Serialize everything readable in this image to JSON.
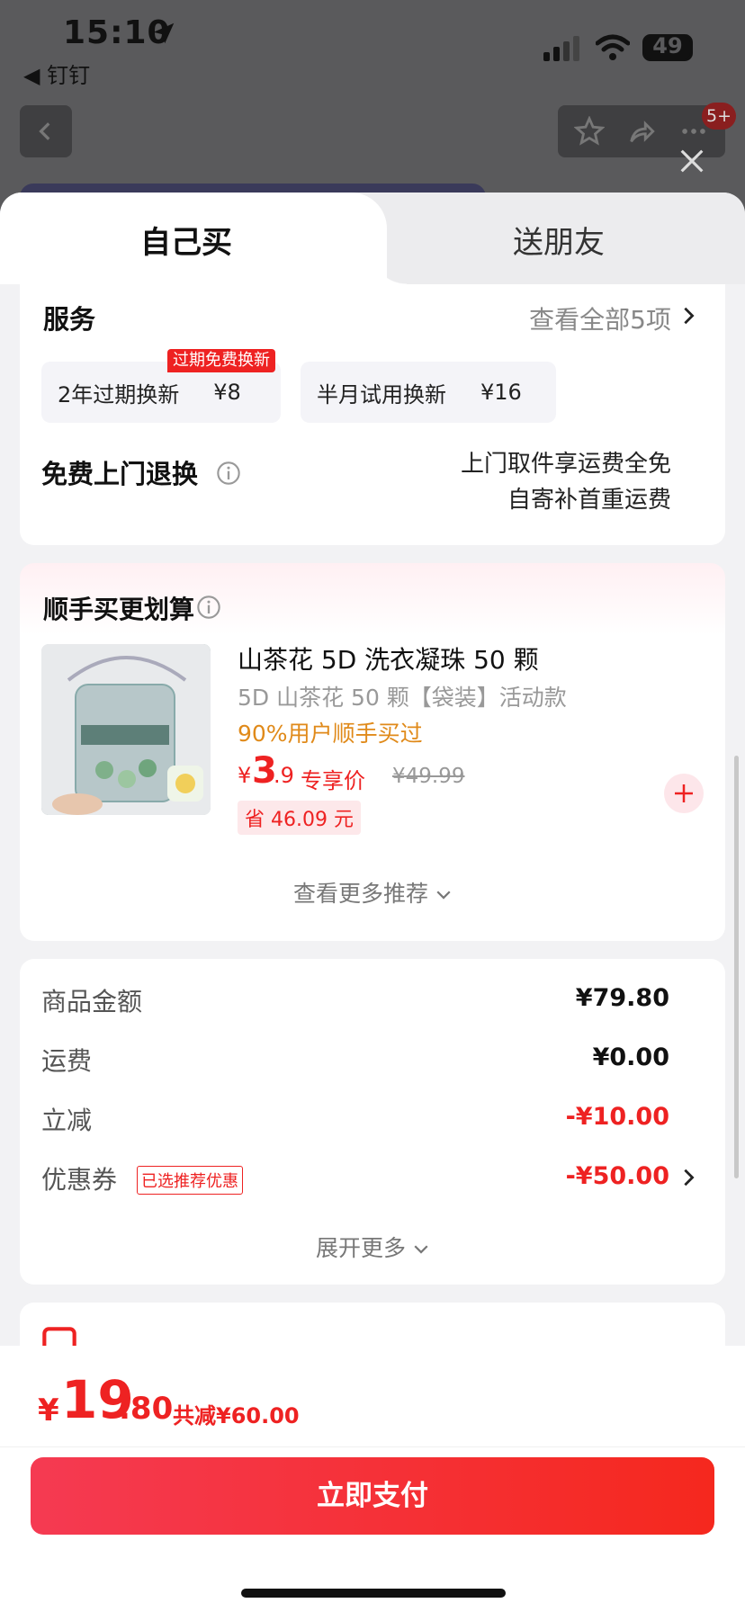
{
  "status": {
    "time": "15:10",
    "back_app": "◀ 钉钉",
    "battery": "49"
  },
  "topbar": {
    "badge": "5+"
  },
  "tabs": [
    {
      "label": "自己买",
      "active": true
    },
    {
      "label": "送朋友",
      "active": false
    }
  ],
  "service": {
    "title": "服务",
    "view_all": "查看全部5项",
    "options": [
      {
        "name": "2年过期换新",
        "price": "¥8",
        "tag": "过期免费换新"
      },
      {
        "name": "半月试用换新",
        "price": "¥16"
      }
    ],
    "return_title": "免费上门退换",
    "return_note_1": "上门取件享运费全免",
    "return_note_2": "自寄补首重运费"
  },
  "recommend": {
    "title": "顺手买更划算",
    "product": {
      "name": "山茶花 5D 洗衣凝珠 50 颗",
      "spec": "5D 山茶花 50 颗【袋装】活动款",
      "buy_rate": "90%用户顺手买过",
      "price_currency": "¥",
      "price_int": "3",
      "price_dec": ".9",
      "price_label": "专享价",
      "original_price": "¥49.99",
      "save": "省 46.09 元"
    },
    "more": "查看更多推荐"
  },
  "summary": {
    "rows": [
      {
        "label": "商品金额",
        "value": "¥79.80"
      },
      {
        "label": "运费",
        "value": "¥0.00"
      },
      {
        "label": "立减",
        "value": "-¥10.00"
      },
      {
        "label": "优惠券",
        "value": "-¥50.00"
      }
    ],
    "coupon_tag": "已选推荐优惠",
    "expand": "展开更多"
  },
  "footer": {
    "currency": "¥",
    "total_int": "19",
    "total_dec": ".80",
    "total_save": "共减¥60.00",
    "pay_label": "立即支付"
  },
  "colors": {
    "accent_red": "#ee2222",
    "pay_gradient_start": "#f53a52",
    "pay_gradient_end": "#f5281e",
    "buy_rate": "#e08a1a"
  }
}
